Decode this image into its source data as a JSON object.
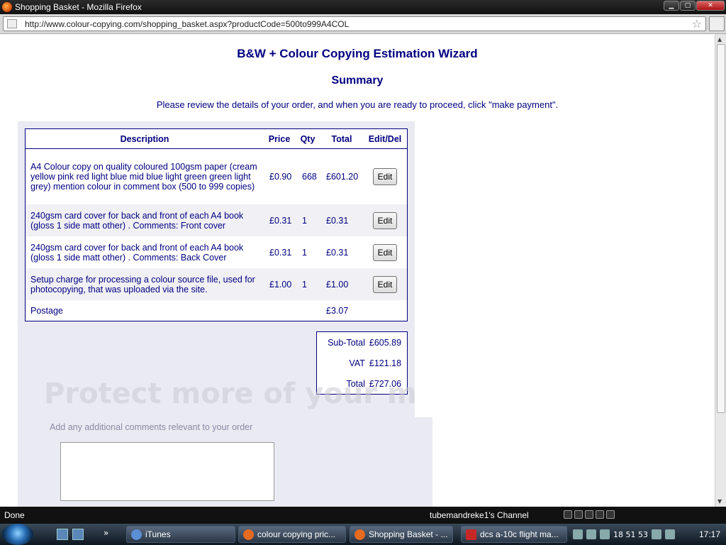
{
  "window": {
    "title": "Shopping Basket - Mozilla Firefox",
    "buttons": {
      "minimize": "▁",
      "maximize": "▢",
      "close": "✕"
    }
  },
  "address": {
    "url": "http://www.colour-copying.com/shopping_basket.aspx?productCode=500to999A4COL",
    "bookmark_icon": "star-icon"
  },
  "page": {
    "heading": "B&W + Colour Copying Estimation Wizard",
    "subheading": "Summary",
    "intro": "Please review the details of your order, and when you are ready to proceed, click \"make payment\".",
    "basket": {
      "headers": {
        "description": "Description",
        "price": "Price",
        "qty": "Qty",
        "total": "Total",
        "edit": "Edit/Del"
      },
      "rows": [
        {
          "description": "A4 Colour copy on quality coloured 100gsm paper (cream yellow pink red light blue mid blue light green green light grey) mention colour in comment box (500 to 999 copies)",
          "price": "£0.90",
          "qty": "668",
          "total": "£601.20",
          "edit": "Edit"
        },
        {
          "description": "240gsm card cover for back and front of each A4 book (gloss 1 side matt other) . Comments: Front cover",
          "price": "£0.31",
          "qty": "1",
          "total": "£0.31",
          "edit": "Edit"
        },
        {
          "description": "240gsm card cover for back and front of each A4 book (gloss 1 side matt other) . Comments: Back Cover",
          "price": "£0.31",
          "qty": "1",
          "total": "£0.31",
          "edit": "Edit"
        },
        {
          "description": "Setup charge for processing a colour source file, used for photocopying, that was uploaded via the site.",
          "price": "£1.00",
          "qty": "1",
          "total": "£1.00",
          "edit": "Edit"
        }
      ],
      "postage": {
        "label": "Postage",
        "total": "£3.07"
      }
    },
    "totals": {
      "subtotal_label": "Sub-Total",
      "subtotal": "£605.89",
      "vat_label": "VAT",
      "vat": "£121.18",
      "total_label": "Total",
      "total": "£727.06"
    },
    "watermark": "Protect more of your m",
    "comments": {
      "label": "Add any additional comments relevant to your order",
      "value": ""
    }
  },
  "statusbar": {
    "status": "Done",
    "channel": "tubemandreke1's Channel"
  },
  "taskbar": {
    "tasks": [
      {
        "label": "iTunes",
        "color": "#5b8fd6"
      },
      {
        "label": "colour copying pric...",
        "color": "#e66a1f"
      },
      {
        "label": "Shopping Basket - ...",
        "color": "#e66a1f"
      },
      {
        "label": "dcs a-10c flight ma...",
        "color": "#c62828"
      }
    ],
    "tray_text": "18 51 53",
    "clock": "17:17"
  }
}
